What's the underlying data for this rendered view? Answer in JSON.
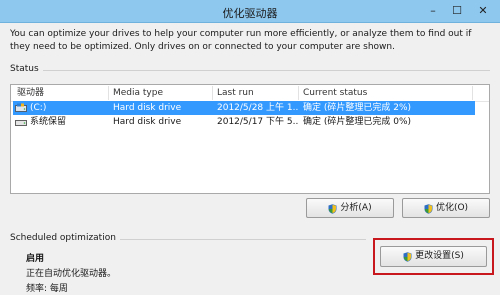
{
  "window": {
    "title": "优化驱动器",
    "controls": [
      "–",
      "☐",
      "✕"
    ]
  },
  "description": "You can optimize your drives to help your computer run more efficiently, or analyze them to find out if they need to be optimized. Only drives on or connected to your computer are shown.",
  "status": {
    "label": "Status",
    "columns": [
      "驱动器",
      "Media type",
      "Last run",
      "Current status"
    ],
    "rows": [
      {
        "drive": "(C:)",
        "media": "Hard disk drive",
        "last_run": "2012/5/28 上午 1...",
        "status": "确定 (碎片整理已完成 2%)",
        "selected": true
      },
      {
        "drive": "系统保留",
        "media": "Hard disk drive",
        "last_run": "2012/5/17 下午 5...",
        "status": "确定 (碎片整理已完成 0%)",
        "selected": false
      }
    ]
  },
  "buttons": {
    "analyze": "分析(A)",
    "optimize": "优化(O)",
    "change_settings": "更改设置(S)"
  },
  "scheduled": {
    "label": "Scheduled optimization",
    "state": "启用",
    "detail": "正在自动优化驱动器。",
    "frequency": "频率: 每周"
  },
  "colors": {
    "selection": "#3399ff",
    "titlebar": "#8ec8ef",
    "highlight": "#c8181e"
  }
}
